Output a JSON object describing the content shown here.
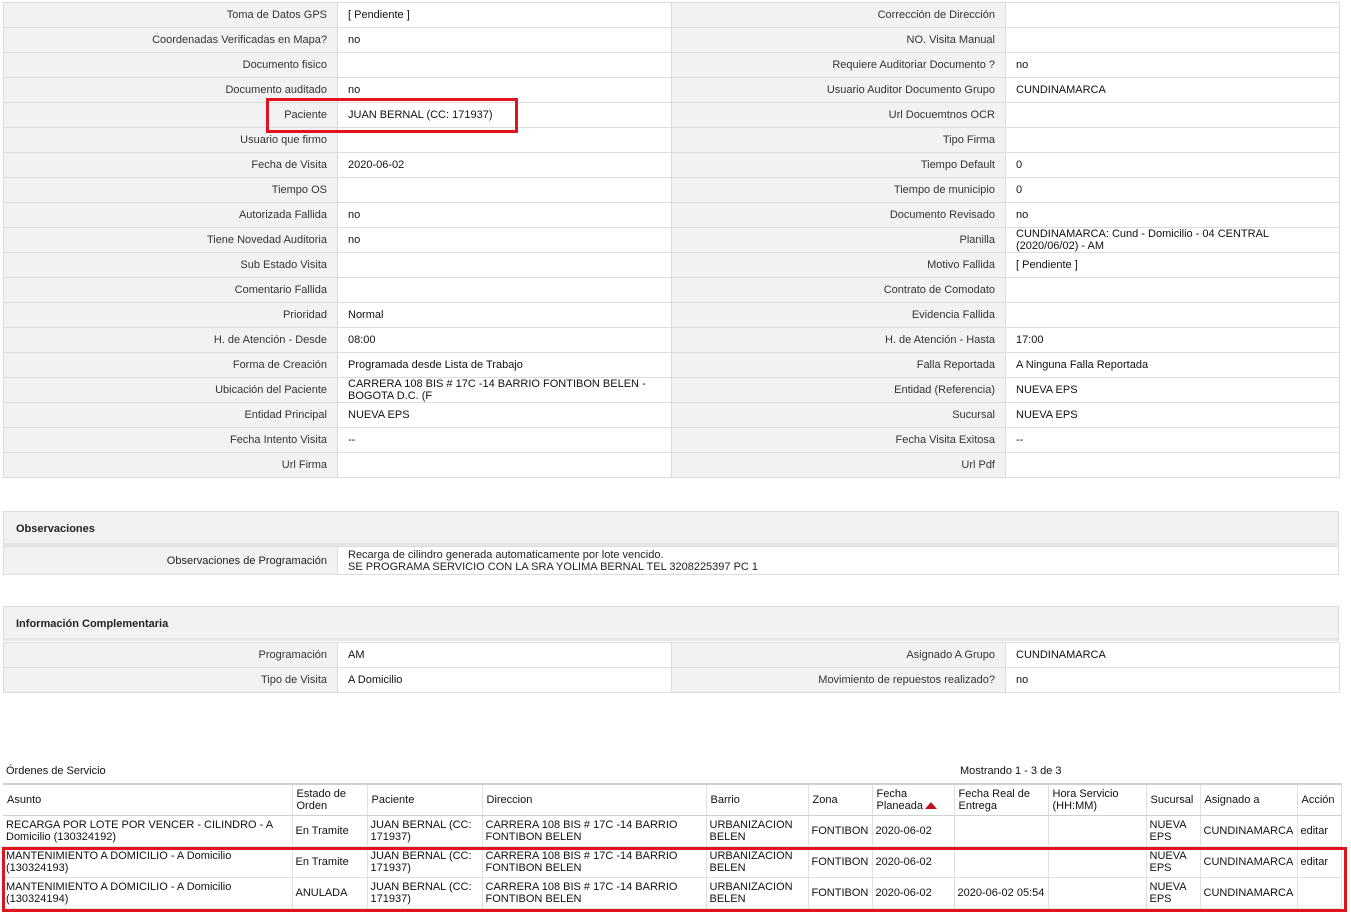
{
  "details": [
    [
      {
        "label": "Toma de Datos GPS",
        "value": "[ Pendiente ]"
      },
      {
        "label": "Corrección de Dirección",
        "value": ""
      }
    ],
    [
      {
        "label": "Coordenadas Verificadas en Mapa?",
        "value": "no"
      },
      {
        "label": "NO. Visita Manual",
        "value": ""
      }
    ],
    [
      {
        "label": "Documento fisico",
        "value": ""
      },
      {
        "label": "Requiere Auditoriar Documento ?",
        "value": "no"
      }
    ],
    [
      {
        "label": "Documento auditado",
        "value": "no"
      },
      {
        "label": "Usuario Auditor Documento Grupo",
        "value": "CUNDINAMARCA"
      }
    ],
    [
      {
        "label": "Paciente",
        "value": "JUAN BERNAL (CC: 171937)"
      },
      {
        "label": "Url Docuemtnos OCR",
        "value": ""
      }
    ],
    [
      {
        "label": "Usuario que firmo",
        "value": ""
      },
      {
        "label": "Tipo Firma",
        "value": ""
      }
    ],
    [
      {
        "label": "Fecha de Visita",
        "value": "2020-06-02"
      },
      {
        "label": "Tiempo Default",
        "value": "0"
      }
    ],
    [
      {
        "label": "Tiempo OS",
        "value": ""
      },
      {
        "label": "Tiempo de municipio",
        "value": "0"
      }
    ],
    [
      {
        "label": "Autorizada Fallida",
        "value": "no"
      },
      {
        "label": "Documento Revisado",
        "value": "no"
      }
    ],
    [
      {
        "label": "Tiene Novedad Auditoria",
        "value": "no"
      },
      {
        "label": "Planilla",
        "value": "CUNDINAMARCA: Cund - Domicilio - 04 CENTRAL (2020/06/02) - AM"
      }
    ],
    [
      {
        "label": "Sub Estado Visita",
        "value": ""
      },
      {
        "label": "Motivo Fallida",
        "value": "[ Pendiente ]"
      }
    ],
    [
      {
        "label": "Comentario Fallida",
        "value": ""
      },
      {
        "label": "Contrato de Comodato",
        "value": ""
      }
    ],
    [
      {
        "label": "Prioridad",
        "value": "Normal"
      },
      {
        "label": "Evidencia Fallida",
        "value": ""
      }
    ],
    [
      {
        "label": "H. de Atención - Desde",
        "value": "08:00"
      },
      {
        "label": "H. de Atención - Hasta",
        "value": "17:00"
      }
    ],
    [
      {
        "label": "Forma de Creación",
        "value": "Programada desde Lista de Trabajo"
      },
      {
        "label": "Falla Reportada",
        "value": "A Ninguna Falla Reportada"
      }
    ],
    [
      {
        "label": "Ubicación del Paciente",
        "value": "CARRERA 108 BIS # 17C -14 BARRIO FONTIBON BELEN - BOGOTA D.C. (F"
      },
      {
        "label": "Entidad (Referencia)",
        "value": "NUEVA EPS"
      }
    ],
    [
      {
        "label": "Entidad Principal",
        "value": "NUEVA EPS"
      },
      {
        "label": "Sucursal",
        "value": "NUEVA EPS"
      }
    ],
    [
      {
        "label": "Fecha Intento Visita",
        "value": "--"
      },
      {
        "label": "Fecha Visita Exitosa",
        "value": "--"
      }
    ],
    [
      {
        "label": "Url Firma",
        "value": ""
      },
      {
        "label": "Url Pdf",
        "value": ""
      }
    ]
  ],
  "observaciones": {
    "title": "Observaciones",
    "label": "Observaciones de Programación",
    "value": " Recarga de cilindro generada automaticamente por lote vencido.\nSE PROGRAMA SERVICIO CON LA SRA YOLIMA BERNAL TEL 3208225397 PC 1"
  },
  "complementaria": {
    "title": "Información Complementaria",
    "rows": [
      [
        {
          "label": "Programación",
          "value": "AM"
        },
        {
          "label": "Asignado A Grupo",
          "value": "CUNDINAMARCA"
        }
      ],
      [
        {
          "label": "Tipo de Visita",
          "value": "A Domicilio"
        },
        {
          "label": "Movimiento de repuestos realizado?",
          "value": "no"
        }
      ]
    ]
  },
  "ordenes": {
    "title": "Órdenes de Servicio",
    "count": "Mostrando 1 - 3 de 3",
    "columns": [
      "Asunto",
      "Estado de Orden",
      "Paciente",
      "Direccion",
      "Barrio",
      "Zona",
      "Fecha Planeada",
      "Fecha Real de Entrega",
      "Hora Servicio (HH:MM)",
      "Sucursal",
      "Asignado a",
      "Acción"
    ],
    "rows": [
      [
        "RECARGA POR LOTE POR VENCER - CILINDRO - A Domicilio (130324192)",
        "En Tramite",
        "JUAN BERNAL (CC: 171937)",
        "CARRERA 108 BIS # 17C -14 BARRIO FONTIBON BELEN",
        "URBANIZACION BELEN",
        "FONTIBON",
        "2020-06-02",
        "",
        "",
        "NUEVA EPS",
        "CUNDINAMARCA",
        "editar"
      ],
      [
        "MANTENIMIENTO A DOMICILIO - A Domicilio (130324193)",
        "En Tramite",
        "JUAN BERNAL (CC: 171937)",
        "CARRERA 108 BIS # 17C -14 BARRIO FONTIBON BELEN",
        "URBANIZACION BELEN",
        "FONTIBON",
        "2020-06-02",
        "",
        "",
        "NUEVA EPS",
        "CUNDINAMARCA",
        "editar"
      ],
      [
        "MANTENIMIENTO A DOMICILIO - A Domicilio (130324194)",
        "ANULADA",
        "JUAN BERNAL (CC: 171937)",
        "CARRERA 108 BIS # 17C -14 BARRIO FONTIBON BELEN",
        "URBANIZACION BELEN",
        "FONTIBON",
        "2020-06-02",
        "2020-06-02 05:54",
        "",
        "NUEVA EPS",
        "CUNDINAMARCA",
        ""
      ]
    ]
  },
  "colors": {
    "highlight": "#e0141e",
    "sort_arrow": "#c0121c",
    "label_bg": "#f2f2f2"
  }
}
